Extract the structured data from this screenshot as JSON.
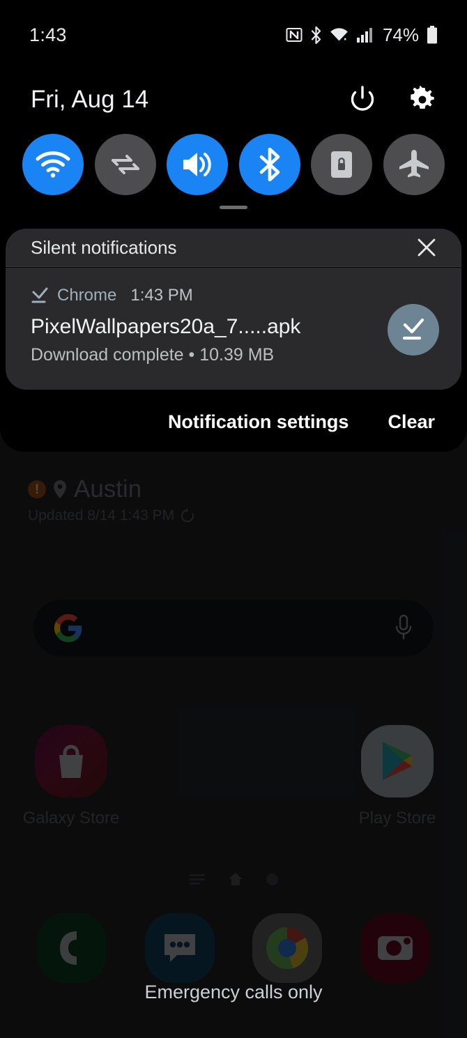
{
  "status_bar": {
    "time": "1:43",
    "battery_percent": "74%",
    "icons": [
      "nfc-icon",
      "bluetooth-icon",
      "wifi-icon",
      "signal-icon",
      "battery-icon"
    ]
  },
  "shade": {
    "date": "Fri, Aug 14",
    "power_button": "power-icon",
    "settings_button": "gear-icon",
    "quick_settings": [
      {
        "name": "wifi",
        "label": "Wi-Fi",
        "state": "on"
      },
      {
        "name": "mobile-data",
        "label": "Mobile data",
        "state": "off"
      },
      {
        "name": "sound",
        "label": "Sound",
        "state": "on"
      },
      {
        "name": "bluetooth",
        "label": "Bluetooth",
        "state": "on"
      },
      {
        "name": "auto-rotate",
        "label": "Auto rotate",
        "state": "off"
      },
      {
        "name": "airplane-mode",
        "label": "Airplane mode",
        "state": "off"
      }
    ],
    "silent_section_title": "Silent notifications",
    "close_label": "close-icon",
    "notification": {
      "app": "Chrome",
      "time": "1:43 PM",
      "title": "PixelWallpapers20a_7.....apk",
      "body": "Download complete • 10.39 MB",
      "action_icon": "download-complete-icon"
    },
    "footer": {
      "settings_label": "Notification settings",
      "clear_label": "Clear"
    }
  },
  "home_screen": {
    "weather": {
      "city": "Austin",
      "updated": "Updated 8/14 1:43 PM"
    },
    "search": {
      "placeholder": "",
      "logo": "google-g-icon",
      "mic": "microphone-icon"
    },
    "apps": [
      {
        "label": "Galaxy Store",
        "icon": "galaxy-store-icon"
      },
      {
        "label": "Play Store",
        "icon": "play-store-icon"
      }
    ],
    "dock": [
      {
        "label": "Phone",
        "icon": "phone-icon"
      },
      {
        "label": "Messages",
        "icon": "messages-icon"
      },
      {
        "label": "Chrome",
        "icon": "chrome-icon"
      },
      {
        "label": "Camera",
        "icon": "camera-icon"
      }
    ],
    "emergency_text": "Emergency calls only"
  },
  "colors": {
    "accent_blue": "#1a84f5",
    "toggle_off": "#4d4d4f",
    "card_bg": "#2a2a2c",
    "shade_bg": "#000000",
    "action_circle": "#6d8494"
  }
}
